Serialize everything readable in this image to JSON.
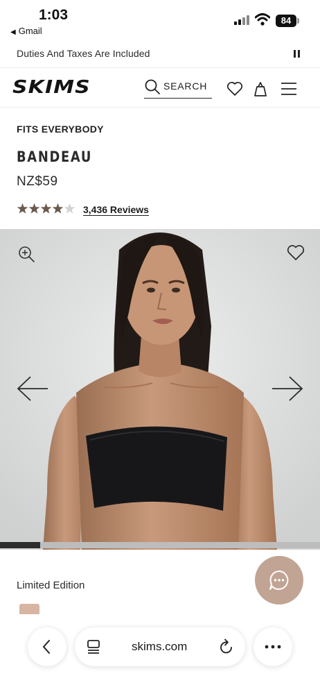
{
  "status_bar": {
    "time": "1:03",
    "back_app": "Gmail",
    "battery": "84"
  },
  "promo": {
    "text": "Duties And Taxes Are Included"
  },
  "header": {
    "logo": "SKIMS",
    "search_label": "SEARCH"
  },
  "product": {
    "eyebrow": "FITS EVERYBODY",
    "title": "BANDEAU",
    "price": "NZ$59",
    "rating": 4,
    "rating_max": 5,
    "reviews_label": "3,436 Reviews"
  },
  "gallery": {
    "progress_fraction": 0.125
  },
  "edition": {
    "label": "Limited Edition"
  },
  "browser": {
    "url": "skims.com"
  },
  "colors": {
    "star_filled": "#6b5a4e",
    "star_empty": "#d6d2cf",
    "chat_bubble": "#c1a494",
    "swatch": "#d7b5a2",
    "garment": "#17171a"
  },
  "icons": {
    "zoom": "zoom-in-icon",
    "wishlist": "heart-icon",
    "bag": "bag-icon",
    "menu": "hamburger-menu-icon",
    "search": "search-icon",
    "prev": "arrow-left-icon",
    "next": "arrow-right-icon",
    "chat": "chat-bubble-icon",
    "tabs": "tabs-icon",
    "reload": "reload-icon",
    "more": "more-dots-icon"
  }
}
